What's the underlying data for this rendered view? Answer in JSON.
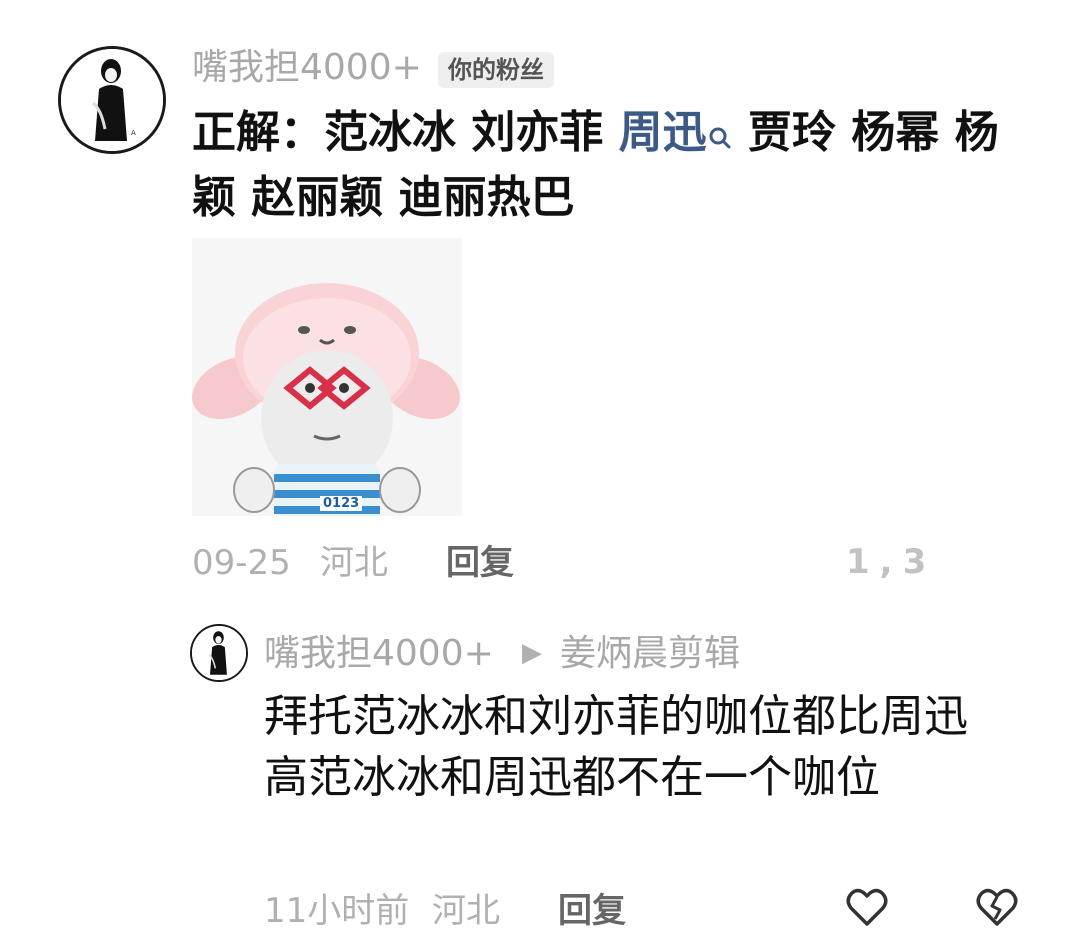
{
  "comment": {
    "username": "嘴我担4000+",
    "badge": "你的粉丝",
    "text_before": "正解：范冰冰 刘亦菲 ",
    "highlight": "周迅",
    "text_after": " 贾玲 杨幂 杨颖 赵丽颖 迪丽热巴",
    "date": "09-25",
    "location": "河北",
    "reply_label": "回复",
    "like_count": "1,3"
  },
  "reply": {
    "username": "嘴我担4000+",
    "target": "姜炳晨剪辑",
    "text": "拜托范冰冰和刘亦菲的咖位都比周迅高范冰冰和周迅都不在一个咖位",
    "time": "11小时前",
    "location": "河北",
    "reply_label": "回复"
  },
  "sticker": {
    "jersey_number": "0123"
  },
  "icons": {
    "search": "search-icon",
    "like": "heart-icon",
    "dislike": "broken-heart-icon",
    "arrow": "play-arrow-icon"
  },
  "colors": {
    "highlight": "#3b5a86",
    "meta": "#b0b0b0",
    "badge_bg": "#efefef"
  }
}
